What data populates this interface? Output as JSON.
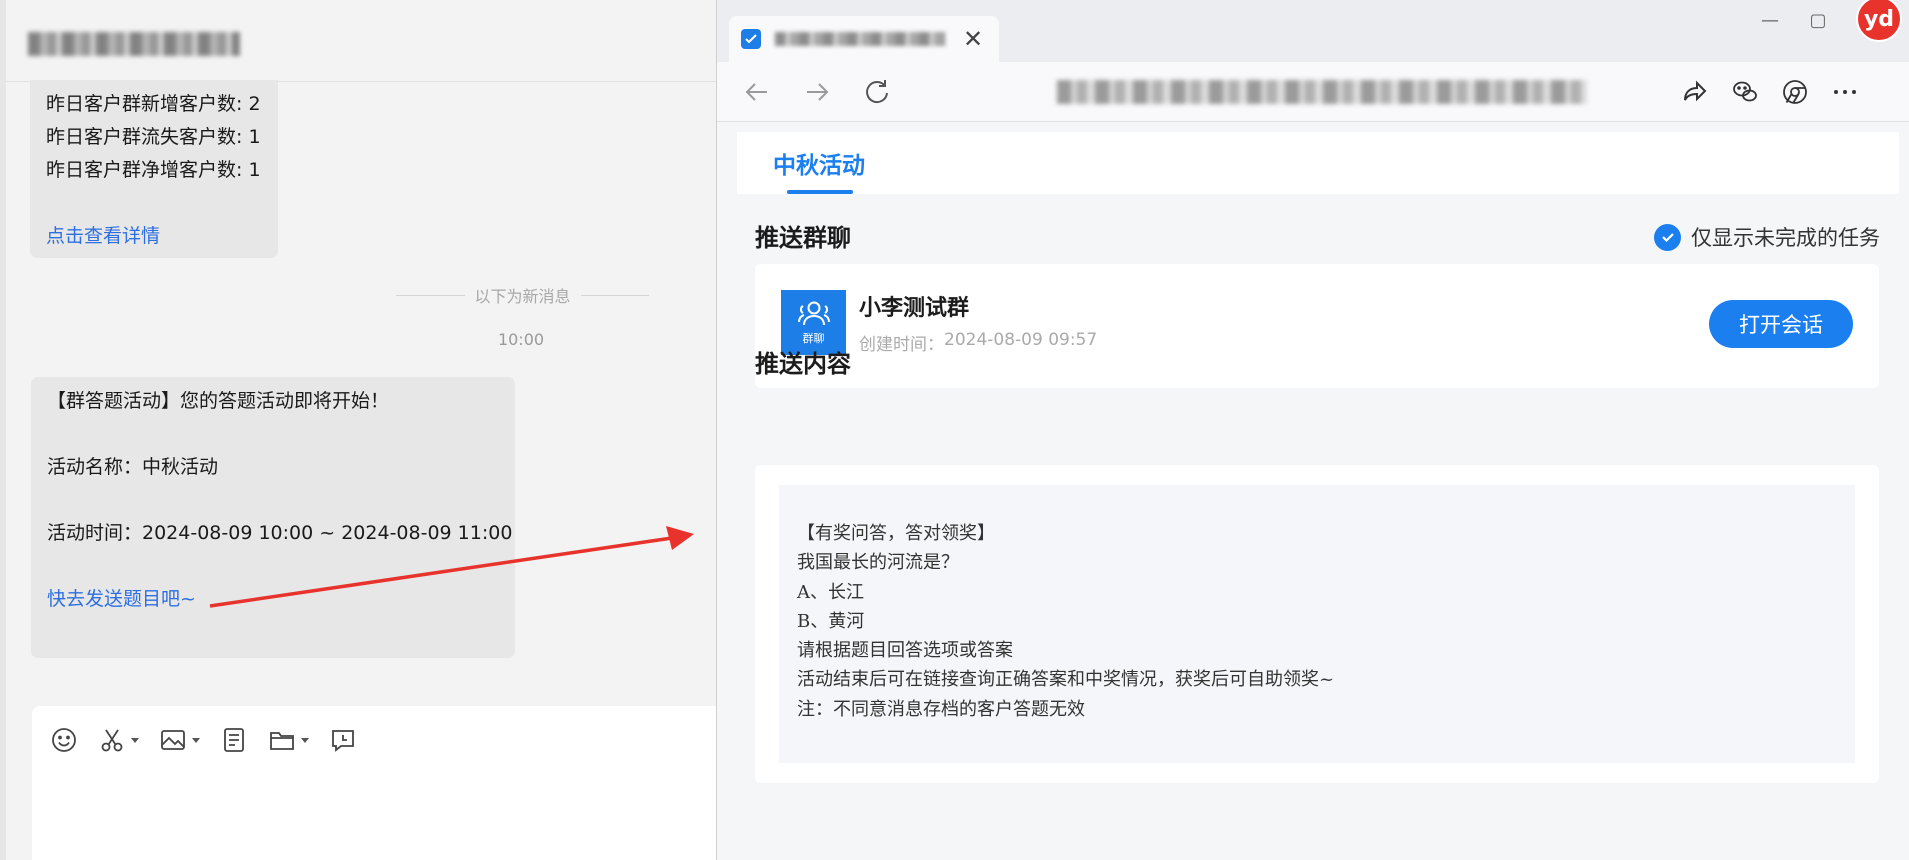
{
  "colors": {
    "accent": "#1b7ff0",
    "link": "#2d6fe0",
    "arrow": "#e8332d"
  },
  "chat": {
    "bubble1": {
      "lines": [
        "昨日客户群新增客户数: 2",
        "昨日客户群流失客户数: 1",
        "昨日客户群净增客户数: 1"
      ],
      "link": "点击查看详情"
    },
    "divider_text": "以下为新消息",
    "time": "10:00",
    "bubble2": {
      "line1": "【群答题活动】您的答题活动即将开始！",
      "line2": "活动名称：中秋活动",
      "line3": "活动时间：2024-08-09 10:00 ~ 2024-08-09 11:00",
      "link": "快去发送题目吧~"
    },
    "toolbar_icons": [
      "emoji-icon",
      "scissors-icon",
      "image-icon",
      "document-icon",
      "folder-icon",
      "clock-message-icon"
    ]
  },
  "browser": {
    "tab_close": "✕",
    "window_controls": {
      "minimize": "—",
      "maximize": "▢"
    },
    "avatar_text": "yd",
    "page": {
      "tab_label": "中秋活动",
      "section1_title": "推送群聊",
      "filter_label": "仅显示未完成的任务",
      "group": {
        "avatar_label": "群聊",
        "name": "小李测试群",
        "created_label": "创建时间：",
        "created_time": "2024-08-09 09:57",
        "open_button": "打开会话"
      },
      "section2_title": "推送内容",
      "content_lines": [
        "【有奖问答，答对领奖】",
        "我国最长的河流是？",
        "A、长江",
        "B、黄河",
        "请根据题目回答选项或答案",
        "活动结束后可在链接查询正确答案和中奖情况，获奖后可自助领奖~",
        "注：不同意消息存档的客户答题无效"
      ]
    }
  }
}
